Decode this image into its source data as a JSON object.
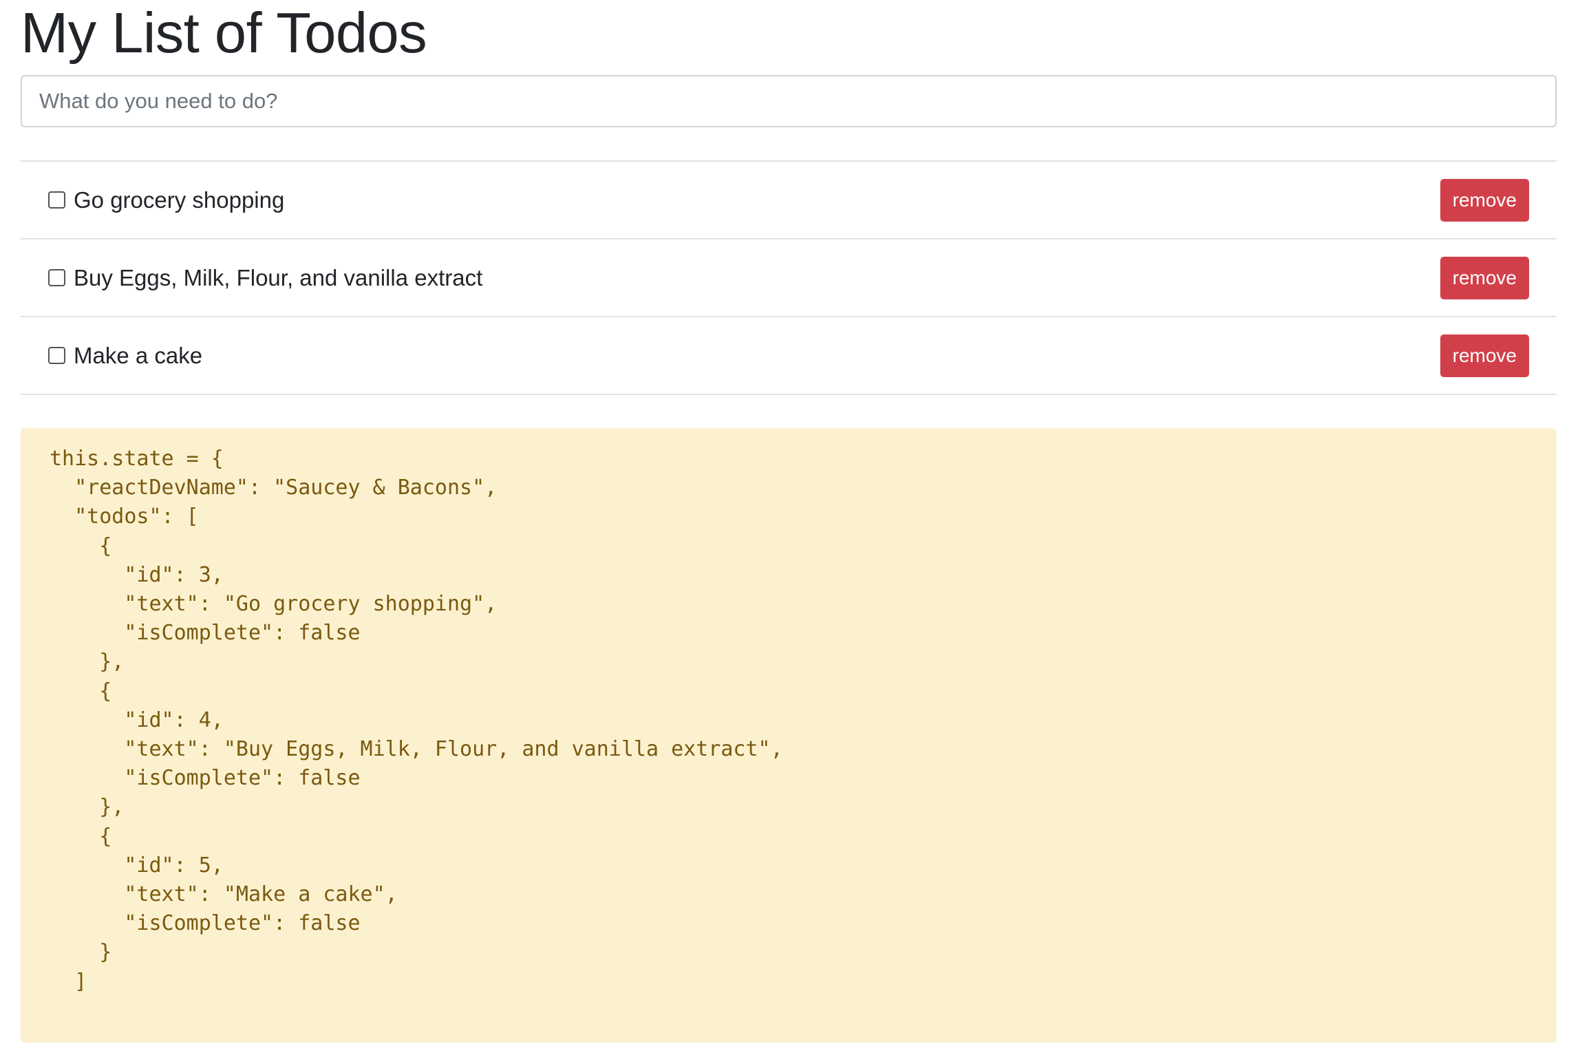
{
  "page": {
    "title": "My List of Todos"
  },
  "input": {
    "placeholder": "What do you need to do?",
    "value": ""
  },
  "todos": [
    {
      "text": "Go grocery shopping",
      "checked": false,
      "button_label": "remove"
    },
    {
      "text": "Buy Eggs, Milk, Flour, and vanilla extract",
      "checked": false,
      "button_label": "remove"
    },
    {
      "text": "Make a cake",
      "checked": false,
      "button_label": "remove"
    }
  ],
  "state_dump": {
    "lines": [
      "this.state = {",
      "  \"reactDevName\": \"Saucey & Bacons\",",
      "  \"todos\": [",
      "    {",
      "      \"id\": 3,",
      "      \"text\": \"Go grocery shopping\",",
      "      \"isComplete\": false",
      "    },",
      "    {",
      "      \"id\": 4,",
      "      \"text\": \"Buy Eggs, Milk, Flour, and vanilla extract\",",
      "      \"isComplete\": false",
      "    },",
      "    {",
      "      \"id\": 5,",
      "      \"text\": \"Make a cake\",",
      "      \"isComplete\": false",
      "    }",
      "  ]",
      "}"
    ]
  },
  "colors": {
    "remove_button_bg": "#d1404a",
    "state_panel_bg": "#fcf1cf",
    "state_text": "#7a5a10",
    "divider": "#dee2e6"
  }
}
